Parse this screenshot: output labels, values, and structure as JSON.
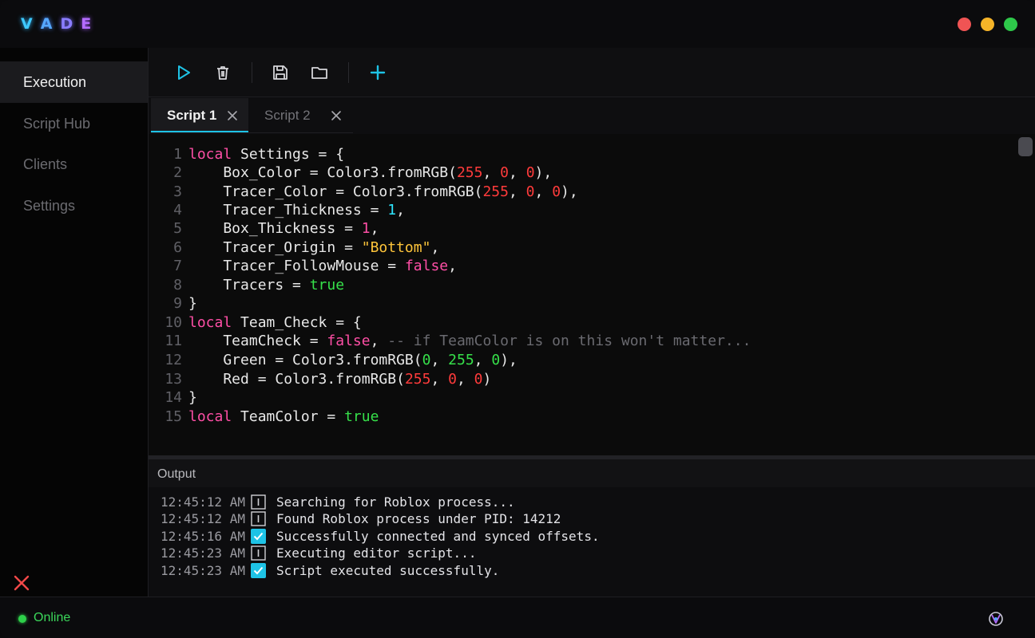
{
  "app": {
    "logo_letters": [
      "V",
      "A",
      "D",
      "E"
    ],
    "traffic_lights": [
      "#f05454",
      "#f5b428",
      "#2ec84a"
    ]
  },
  "sidebar": {
    "items": [
      {
        "label": "Execution",
        "active": true
      },
      {
        "label": "Script Hub",
        "active": false
      },
      {
        "label": "Clients",
        "active": false
      },
      {
        "label": "Settings",
        "active": false
      }
    ],
    "exit_icon": "close-icon"
  },
  "toolbar": {
    "buttons": [
      "play-icon",
      "trash-icon",
      "save-icon",
      "folder-icon",
      "plus-icon"
    ],
    "accent": "#1ec3e6"
  },
  "tabs": [
    {
      "label": "Script 1",
      "active": true
    },
    {
      "label": "Script 2",
      "active": false
    }
  ],
  "editor": {
    "lines": [
      {
        "n": "1"
      },
      {
        "n": "2"
      },
      {
        "n": "3"
      },
      {
        "n": "4"
      },
      {
        "n": "5"
      },
      {
        "n": "6"
      },
      {
        "n": "7"
      },
      {
        "n": "8"
      },
      {
        "n": "9"
      },
      {
        "n": "10"
      },
      {
        "n": "11"
      },
      {
        "n": "12"
      },
      {
        "n": "13"
      },
      {
        "n": "14"
      },
      {
        "n": "15"
      }
    ],
    "tokens": {
      "l1": [
        "local",
        " Settings = {"
      ],
      "l2": [
        "    Box_Color = Color3.fromRGB(",
        "255",
        ", ",
        "0",
        ", ",
        "0",
        "),"
      ],
      "l3": [
        "    Tracer_Color = Color3.fromRGB(",
        "255",
        ", ",
        "0",
        ", ",
        "0",
        "),"
      ],
      "l4": [
        "    Tracer_Thickness = ",
        "1",
        ","
      ],
      "l5": [
        "    Box_Thickness = ",
        "1",
        ","
      ],
      "l6": [
        "    Tracer_Origin = ",
        "\"Bottom\"",
        ","
      ],
      "l7": [
        "    Tracer_FollowMouse = ",
        "false",
        ","
      ],
      "l8": [
        "    Tracers = ",
        "true"
      ],
      "l9": [
        "}"
      ],
      "l10": [
        "local",
        " Team_Check = {"
      ],
      "l11": [
        "    TeamCheck = ",
        "false",
        ", ",
        "-- if TeamColor is on this won't matter..."
      ],
      "l12": [
        "    Green = Color3.fromRGB(",
        "0",
        ", ",
        "255",
        ", ",
        "0",
        "),"
      ],
      "l13": [
        "    Red = Color3.fromRGB(",
        "255",
        ", ",
        "0",
        ", ",
        "0",
        ")"
      ],
      "l14": [
        "}"
      ],
      "l15": [
        "local",
        " TeamColor = ",
        "true"
      ]
    }
  },
  "output": {
    "title": "Output",
    "logs": [
      {
        "time": "12:45:12 AM",
        "type": "info",
        "msg": "Searching for Roblox process..."
      },
      {
        "time": "12:45:12 AM",
        "type": "info",
        "msg": "Found Roblox process under PID: 14212"
      },
      {
        "time": "12:45:16 AM",
        "type": "success",
        "msg": "Successfully connected and synced offsets."
      },
      {
        "time": "12:45:23 AM",
        "type": "info",
        "msg": "Executing editor script..."
      },
      {
        "time": "12:45:23 AM",
        "type": "success",
        "msg": "Script executed successfully."
      }
    ]
  },
  "status": {
    "label": "Online",
    "color": "#2ed14a"
  }
}
